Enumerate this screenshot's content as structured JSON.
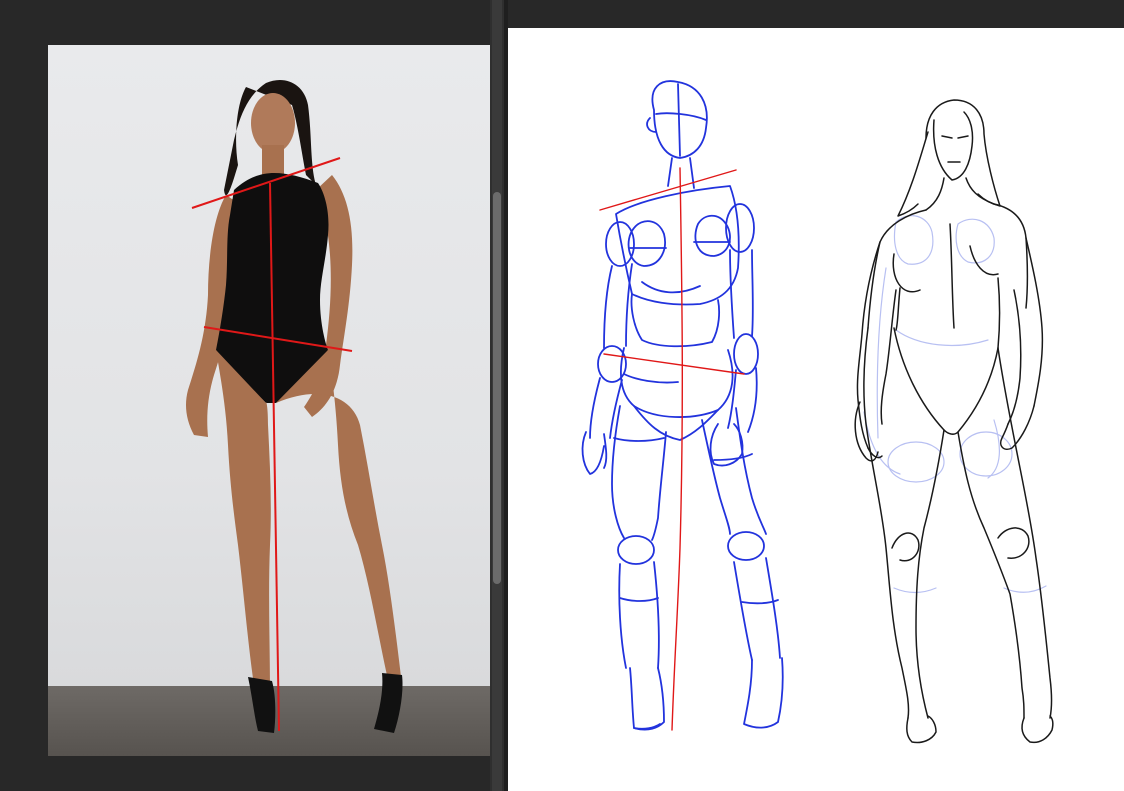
{
  "reference_panel": {
    "image": "photo-reference-standing-figure",
    "overlay_color": "#e01818"
  },
  "sketch_panel": {
    "mannequin_color": "#2233dd",
    "guideline_color": "#e01818",
    "lineart_color": "#1a1a1a",
    "construction_color": "#b8c0f2"
  },
  "ui": {
    "background": "#282828",
    "scrollbar_thumb": "#6b6b6b"
  }
}
